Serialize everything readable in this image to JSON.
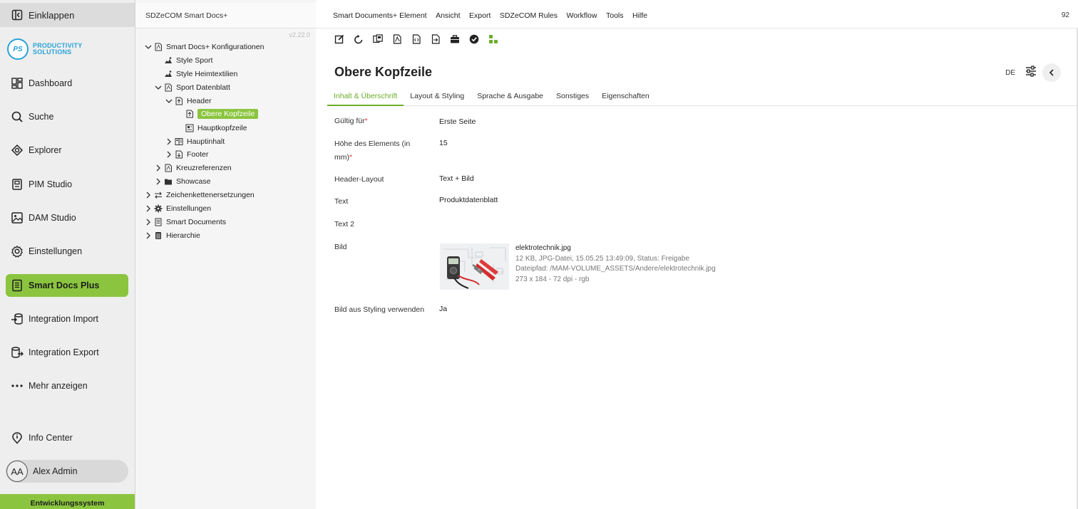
{
  "leftnav": {
    "collapse_label": "Einklappen",
    "logo_mark": "PS",
    "logo_line1": "PRODUCTIVITY",
    "logo_line2": "SOLUTIONS",
    "items": [
      {
        "label": "Dashboard",
        "icon": "dashboard-icon"
      },
      {
        "label": "Suche",
        "icon": "search-icon"
      },
      {
        "label": "Explorer",
        "icon": "explorer-icon"
      },
      {
        "label": "PIM Studio",
        "icon": "pim-studio-icon"
      },
      {
        "label": "DAM Studio",
        "icon": "image-icon"
      },
      {
        "label": "Einstellungen",
        "icon": "gear-icon"
      },
      {
        "label": "Smart Docs Plus",
        "icon": "document-icon",
        "active": true
      },
      {
        "label": "Integration Import",
        "icon": "import-icon"
      },
      {
        "label": "Integration Export",
        "icon": "export-icon"
      },
      {
        "label": "Mehr anzeigen",
        "icon": "more-icon"
      },
      {
        "label": "Info Center",
        "icon": "info-icon"
      }
    ],
    "user": {
      "initials": "AA",
      "name": "Alex Admin"
    },
    "environment": "Entwicklungssystem"
  },
  "tree": {
    "title": "SDZeCOM Smart Docs+",
    "version": "v2.22.0",
    "nodes": [
      {
        "label": "Smart Docs+ Konfigurationen",
        "expanded": true
      },
      {
        "label": "Style Sport"
      },
      {
        "label": "Style Heimtextilien"
      },
      {
        "label": "Sport Datenblatt",
        "expanded": true
      },
      {
        "label": "Header",
        "expanded": true
      },
      {
        "label": "Obere Kopfzeile",
        "selected": true
      },
      {
        "label": "Hauptkopfzeile"
      },
      {
        "label": "Hauptinhalt"
      },
      {
        "label": "Footer"
      },
      {
        "label": "Kreuzreferenzen"
      },
      {
        "label": "Showcase"
      },
      {
        "label": "Zeichenkettenersetzungen"
      },
      {
        "label": "Einstellungen"
      },
      {
        "label": "Smart Documents"
      },
      {
        "label": "Hierarchie"
      }
    ]
  },
  "menubar": {
    "items": [
      "Smart Documents+ Element",
      "Ansicht",
      "Export",
      "SDZeCOM Rules",
      "Workflow",
      "Tools",
      "Hilfe"
    ],
    "counter": "92"
  },
  "toolbar": {
    "icons": [
      "edit-icon",
      "refresh-icon",
      "compare-icon",
      "pdf-icon",
      "pdf-code-icon",
      "pdf-export-icon",
      "briefcase-icon",
      "check-circle-icon",
      "workflow-icon"
    ]
  },
  "page": {
    "title": "Obere Kopfzeile",
    "language": "DE",
    "tabs": [
      "Inhalt & Überschrift",
      "Layout & Styling",
      "Sprache & Ausgabe",
      "Sonstiges",
      "Eigenschaften"
    ],
    "active_tab": 0
  },
  "fields": {
    "valid_for": {
      "label": "Gültig für",
      "value": "Erste Seite"
    },
    "height": {
      "label_line1": "Höhe des Elements (in",
      "label_line2": "mm)",
      "value": "15"
    },
    "header_layout": {
      "label": "Header-Layout",
      "value": "Text + Bild"
    },
    "text": {
      "label": "Text",
      "value": "Produktdatenblatt"
    },
    "text2": {
      "label": "Text 2",
      "value": ""
    },
    "image": {
      "label": "Bild",
      "filename": "elektrotechnik.jpg",
      "meta": "12 KB, JPG-Datei, 15.05.25 13:49:09, Status: Freigabe",
      "path": "Dateipfad: /MAM-VOLUME_ASSETS/Andere/elektrotechnik.jpg",
      "dimensions": "273 x 184 - 72 dpi - rgb"
    },
    "use_styling_image": {
      "label": "Bild aus Styling verwenden",
      "value": "Ja"
    }
  },
  "colors": {
    "accent": "#8bc53f",
    "logo": "#29a3d8",
    "required": "#e53935",
    "tab_active": "#6aae2a"
  }
}
